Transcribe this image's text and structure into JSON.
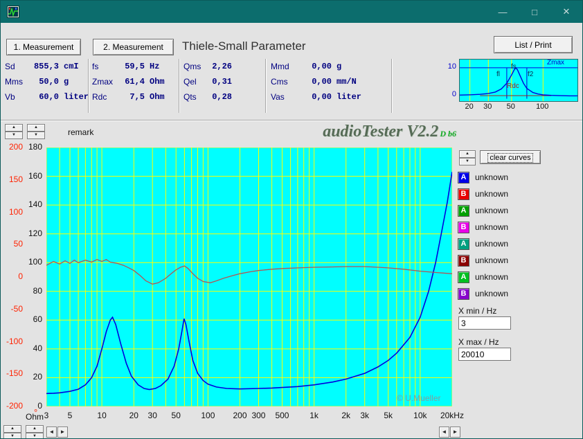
{
  "window": {
    "controls": {
      "minimize": "—",
      "maximize": "□",
      "close": "✕"
    }
  },
  "toolbar": {
    "measurement1_label": "1. Measurement",
    "measurement2_label": "2. Measurement",
    "heading": "Thiele-Small Parameter",
    "list_print_label": "List / Print"
  },
  "parameters": {
    "groups": [
      {
        "rows": [
          {
            "label": "Sd",
            "value": "855,3",
            "unit": "cmI"
          },
          {
            "label": "Mms",
            "value": "50,0",
            "unit": "g"
          },
          {
            "label": "Vb",
            "value": "60,0",
            "unit": "liter"
          }
        ]
      },
      {
        "rows": [
          {
            "label": "fs",
            "value": "59,5",
            "unit": "Hz"
          },
          {
            "label": "Zmax",
            "value": "61,4",
            "unit": "Ohm"
          },
          {
            "label": "Rdc",
            "value": "7,5",
            "unit": "Ohm"
          }
        ]
      },
      {
        "rows": [
          {
            "label": "Qms",
            "value": "2,26",
            "unit": ""
          },
          {
            "label": "Qel",
            "value": "0,31",
            "unit": ""
          },
          {
            "label": "Qts",
            "value": "0,28",
            "unit": ""
          }
        ]
      },
      {
        "rows": [
          {
            "label": "Mmd",
            "value": "0,00",
            "unit": "g"
          },
          {
            "label": "Cms",
            "value": "0,00",
            "unit": "mm/N"
          },
          {
            "label": "Vas",
            "value": "0,00",
            "unit": "liter"
          }
        ]
      }
    ]
  },
  "mini_chart": {
    "zmax_label": "Zmax",
    "fs_label": "fs",
    "f1_label": "fl",
    "f2_label": "f2",
    "rdc_label": "Rdc",
    "y_ticks": [
      "10",
      "0"
    ],
    "x_ticks": [
      [
        20,
        "20"
      ],
      [
        30,
        "30"
      ],
      [
        50,
        "50"
      ],
      [
        100,
        "100"
      ]
    ],
    "x_range": [
      16,
      220
    ],
    "zmax_value": 62,
    "rdc_value": 8,
    "f1": 45,
    "f2": 70,
    "curve": [
      [
        16,
        9
      ],
      [
        20,
        9.5
      ],
      [
        25,
        10.5
      ],
      [
        30,
        12
      ],
      [
        35,
        15
      ],
      [
        40,
        21
      ],
      [
        45,
        32
      ],
      [
        50,
        48
      ],
      [
        53,
        58
      ],
      [
        55,
        62
      ],
      [
        57,
        58
      ],
      [
        60,
        48
      ],
      [
        65,
        32
      ],
      [
        70,
        22
      ],
      [
        80,
        14
      ],
      [
        90,
        11
      ],
      [
        100,
        9.5
      ],
      [
        120,
        8.5
      ],
      [
        140,
        8
      ],
      [
        180,
        7.5
      ],
      [
        220,
        7.5
      ]
    ]
  },
  "workspace": {
    "remark_label": "remark",
    "logo_text": "audioTester V2.2",
    "logo_suffix": "D b6"
  },
  "right_panel": {
    "clear_curves_label": "clear curves",
    "legend": [
      {
        "letter": "A",
        "color": "#0000e8",
        "label": "unknown"
      },
      {
        "letter": "B",
        "color": "#e80000",
        "label": "unknown"
      },
      {
        "letter": "A",
        "color": "#00a000",
        "label": "unknown"
      },
      {
        "letter": "B",
        "color": "#e800e8",
        "label": "unknown"
      },
      {
        "letter": "A",
        "color": "#00a080",
        "label": "unknown"
      },
      {
        "letter": "B",
        "color": "#8b0000",
        "label": "unknown"
      },
      {
        "letter": "A",
        "color": "#00c020",
        "label": "unknown"
      },
      {
        "letter": "B",
        "color": "#8800cc",
        "label": "unknown"
      }
    ],
    "xmin_label": "X min / Hz",
    "xmin_value": "3",
    "xmax_label": "X max / Hz",
    "xmax_value": "20010"
  },
  "chart_data": {
    "type": "line",
    "watermark": "© U.Mueller",
    "bg_color": "#00ffff",
    "grid_color": "#ffff00",
    "x_axis": {
      "scale": "log",
      "min": 3,
      "max": 20010,
      "ticks": [
        [
          3,
          "3"
        ],
        [
          5,
          "5"
        ],
        [
          10,
          "10"
        ],
        [
          20,
          "20"
        ],
        [
          30,
          "30"
        ],
        [
          50,
          "50"
        ],
        [
          100,
          "100"
        ],
        [
          200,
          "200"
        ],
        [
          300,
          "300"
        ],
        [
          500,
          "500"
        ],
        [
          1000,
          "1k"
        ],
        [
          2000,
          "2k"
        ],
        [
          3000,
          "3k"
        ],
        [
          5000,
          "5k"
        ],
        [
          10000,
          "10k"
        ],
        [
          20000,
          "20kHz"
        ]
      ]
    },
    "y_ohm_axis": {
      "unit": "Ohm",
      "min": 0,
      "max": 180,
      "ticks": [
        180,
        160,
        140,
        120,
        100,
        80,
        60,
        40,
        20,
        0
      ]
    },
    "y_phase_axis": {
      "unit": "°",
      "min": -200,
      "max": 200,
      "ticks": [
        200,
        150,
        100,
        50,
        0,
        -50,
        -100,
        -150,
        -200
      ]
    },
    "series": [
      {
        "name": "impedance",
        "axis": "ohm",
        "color": "#0000dd",
        "points": [
          [
            3,
            9
          ],
          [
            3.5,
            9.2
          ],
          [
            4,
            9.5
          ],
          [
            5,
            10.5
          ],
          [
            6,
            12
          ],
          [
            7,
            15
          ],
          [
            8,
            20
          ],
          [
            9,
            28
          ],
          [
            10,
            40
          ],
          [
            11,
            52
          ],
          [
            12,
            60
          ],
          [
            12.6,
            62
          ],
          [
            13.5,
            57
          ],
          [
            15,
            44
          ],
          [
            17,
            30
          ],
          [
            19,
            21
          ],
          [
            22,
            15
          ],
          [
            25,
            12.5
          ],
          [
            28,
            11.8
          ],
          [
            32,
            12.5
          ],
          [
            36,
            14.5
          ],
          [
            42,
            19
          ],
          [
            48,
            28
          ],
          [
            53,
            40
          ],
          [
            57,
            53
          ],
          [
            59.5,
            61
          ],
          [
            62,
            57
          ],
          [
            66,
            46
          ],
          [
            72,
            32
          ],
          [
            80,
            23
          ],
          [
            90,
            18
          ],
          [
            100,
            15.5
          ],
          [
            120,
            13.5
          ],
          [
            150,
            12.5
          ],
          [
            200,
            12.2
          ],
          [
            300,
            12.5
          ],
          [
            400,
            12.8
          ],
          [
            500,
            13.2
          ],
          [
            700,
            13.8
          ],
          [
            1000,
            15
          ],
          [
            1500,
            17
          ],
          [
            2000,
            19
          ],
          [
            3000,
            23
          ],
          [
            4000,
            27.5
          ],
          [
            5000,
            32
          ],
          [
            6000,
            37
          ],
          [
            8000,
            48
          ],
          [
            10000,
            62
          ],
          [
            12000,
            80
          ],
          [
            14000,
            100
          ],
          [
            16000,
            122
          ],
          [
            18000,
            142
          ],
          [
            20000,
            163
          ]
        ]
      },
      {
        "name": "phase",
        "axis": "phase",
        "color": "#b25555",
        "points": [
          [
            3,
            18
          ],
          [
            3.5,
            24
          ],
          [
            4,
            20
          ],
          [
            4.5,
            25
          ],
          [
            5,
            21
          ],
          [
            5.5,
            26
          ],
          [
            6,
            22
          ],
          [
            7,
            26
          ],
          [
            8,
            23
          ],
          [
            9,
            27
          ],
          [
            10,
            24
          ],
          [
            11,
            27
          ],
          [
            12,
            23
          ],
          [
            14,
            21
          ],
          [
            16,
            18
          ],
          [
            18,
            14
          ],
          [
            20,
            10
          ],
          [
            23,
            2
          ],
          [
            26,
            -6
          ],
          [
            30,
            -11
          ],
          [
            34,
            -9
          ],
          [
            40,
            -2
          ],
          [
            45,
            5
          ],
          [
            50,
            11
          ],
          [
            55,
            15
          ],
          [
            60,
            17
          ],
          [
            65,
            13
          ],
          [
            72,
            5
          ],
          [
            80,
            -2
          ],
          [
            90,
            -7
          ],
          [
            105,
            -9
          ],
          [
            120,
            -6
          ],
          [
            140,
            -2
          ],
          [
            170,
            2
          ],
          [
            200,
            5
          ],
          [
            250,
            8
          ],
          [
            300,
            10
          ],
          [
            400,
            12
          ],
          [
            500,
            13
          ],
          [
            700,
            14
          ],
          [
            1000,
            15
          ],
          [
            1500,
            15.5
          ],
          [
            2000,
            16
          ],
          [
            3000,
            16
          ],
          [
            4000,
            15
          ],
          [
            5000,
            14
          ],
          [
            7000,
            12
          ],
          [
            10000,
            9
          ],
          [
            14000,
            7
          ],
          [
            20000,
            5
          ]
        ]
      }
    ]
  }
}
